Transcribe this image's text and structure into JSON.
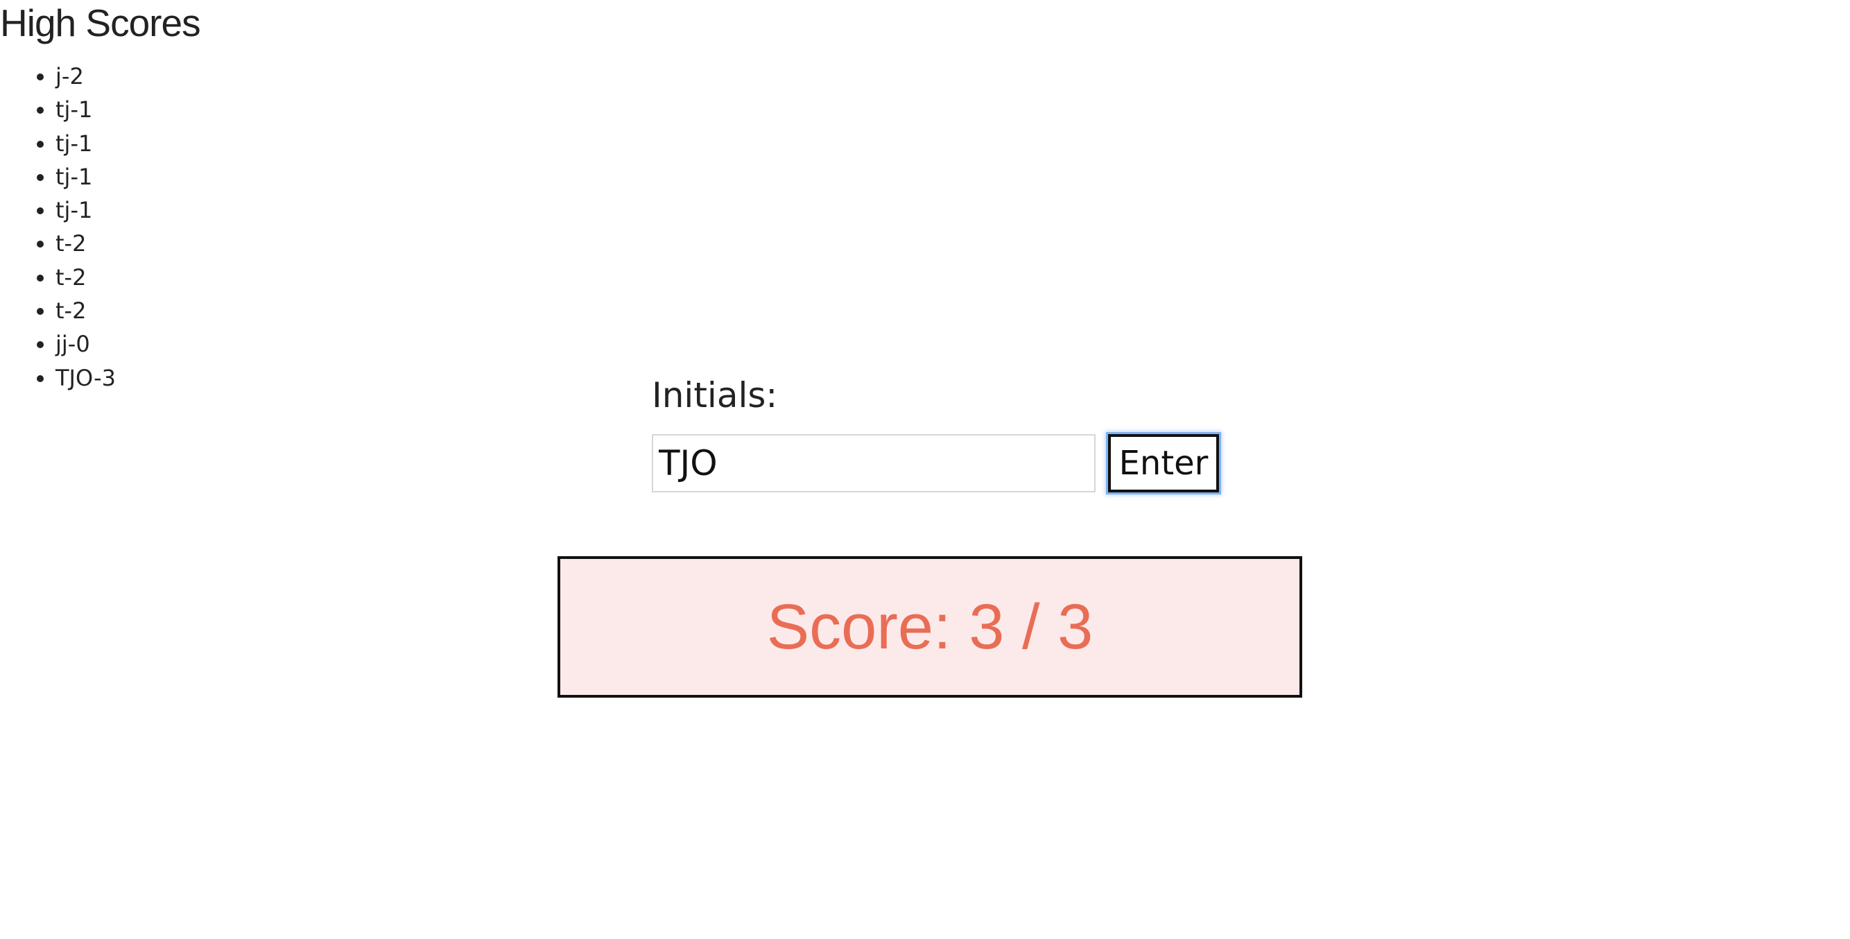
{
  "high_scores": {
    "title": "High Scores",
    "entries": [
      "j-2",
      "tj-1",
      "tj-1",
      "tj-1",
      "tj-1",
      "t-2",
      "t-2",
      "t-2",
      "jj-0",
      "TJO-3"
    ]
  },
  "form": {
    "label": "Initials:",
    "input_value": "TJO",
    "button_label": "Enter"
  },
  "result": {
    "score_text": "Score: 3 / 3"
  },
  "colors": {
    "score_text": "#e96d55",
    "score_panel_bg": "#fceaea",
    "focus_ring": "#7fb2f0"
  }
}
